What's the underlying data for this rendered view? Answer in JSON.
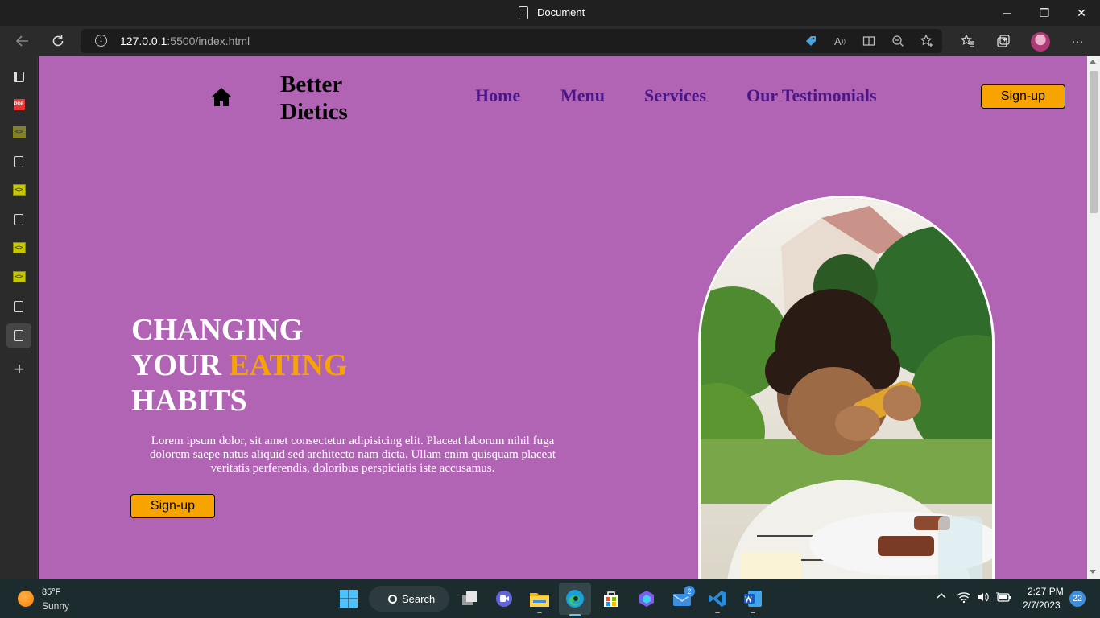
{
  "browser": {
    "title": "Document",
    "url_host": "127.0.0.1",
    "url_path": ":5500/index.html",
    "controls": {
      "minimize": "─",
      "restore": "❐",
      "close": "✕"
    },
    "icons": [
      "back-icon",
      "refresh-icon",
      "info-icon",
      "coupon-tag-icon",
      "read-aloud-icon",
      "immersive-reader-icon",
      "zoom-out-icon",
      "add-favorite-icon",
      "favorites-icon",
      "collections-icon",
      "profile-avatar",
      "more-menu-icon"
    ]
  },
  "sidebar": {
    "tabs": [
      {
        "icon": "tab-actions-icon"
      },
      {
        "icon": "pdf-icon",
        "label": "PDF"
      },
      {
        "icon": "code-file-icon"
      },
      {
        "icon": "page-icon"
      },
      {
        "icon": "code-file-icon"
      },
      {
        "icon": "page-icon"
      },
      {
        "icon": "code-file-icon"
      },
      {
        "icon": "code-file-icon"
      },
      {
        "icon": "page-icon"
      },
      {
        "icon": "page-icon",
        "active": true
      }
    ],
    "new_tab_icon": "+"
  },
  "page": {
    "colors": {
      "background": "#b264b4",
      "nav_link": "#4b1688",
      "accent": "#f7a400",
      "heading": "#ffffff"
    },
    "brand": {
      "line1": "Better",
      "line2": "Dietics"
    },
    "nav": [
      "Home",
      "Menu",
      "Services",
      "Our Testimonials"
    ],
    "header_signup": "Sign-up",
    "hero": {
      "line1": "CHANGING",
      "line2_plain": "YOUR ",
      "line2_accent": "EATING",
      "line3": "HABITS",
      "paragraph": "Lorem ipsum dolor, sit amet consectetur adipisicing elit. Placeat laborum nihil fuga dolorem saepe natus aliquid sed architecto nam dicta. Ullam enim quisquam placeat veritatis perferendis, doloribus perspiciatis iste accusamus.",
      "signup": "Sign-up"
    }
  },
  "taskbar": {
    "weather": {
      "temp": "85°F",
      "condition": "Sunny"
    },
    "search_label": "Search",
    "mail_badge": "2",
    "clock": {
      "time": "2:27 PM",
      "date": "2/7/2023"
    },
    "notifications": "22"
  }
}
